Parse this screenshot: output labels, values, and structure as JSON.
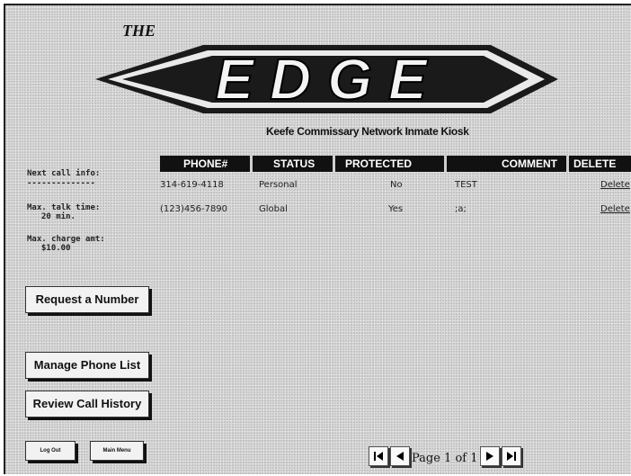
{
  "header": {
    "logo_prefix": "THE",
    "logo_text": "EDGE",
    "subtitle": "Keefe Commissary Network Inmate Kiosk"
  },
  "sidebar": {
    "next_call_label": "Next call info:",
    "divider": "--------------",
    "max_talk_label": "Max. talk time:",
    "max_talk_value": "20 min.",
    "max_charge_label": "Max. charge amt:",
    "max_charge_value": "$10.00",
    "request_button": "Request a Number",
    "manage_button": "Manage Phone List",
    "history_button": "Review Call History",
    "logout_button": "Log Out",
    "main_menu_button": "Main Menu"
  },
  "table": {
    "columns": [
      "PHONE#",
      "STATUS",
      "PROTECTED",
      "COMMENT",
      "DELETE"
    ],
    "rows": [
      {
        "phone": "314-619-4118",
        "status": "Personal",
        "protected": "No",
        "comment": "TEST",
        "delete": "Delete"
      },
      {
        "phone": "(123)456-7890",
        "status": "Global",
        "protected": "Yes",
        "comment": ";a;",
        "delete": "Delete"
      }
    ]
  },
  "pagination": {
    "label": "Page 1 of 1",
    "first_icon": "first-page-icon",
    "prev_icon": "previous-page-icon",
    "next_icon": "next-page-icon",
    "last_icon": "last-page-icon"
  }
}
